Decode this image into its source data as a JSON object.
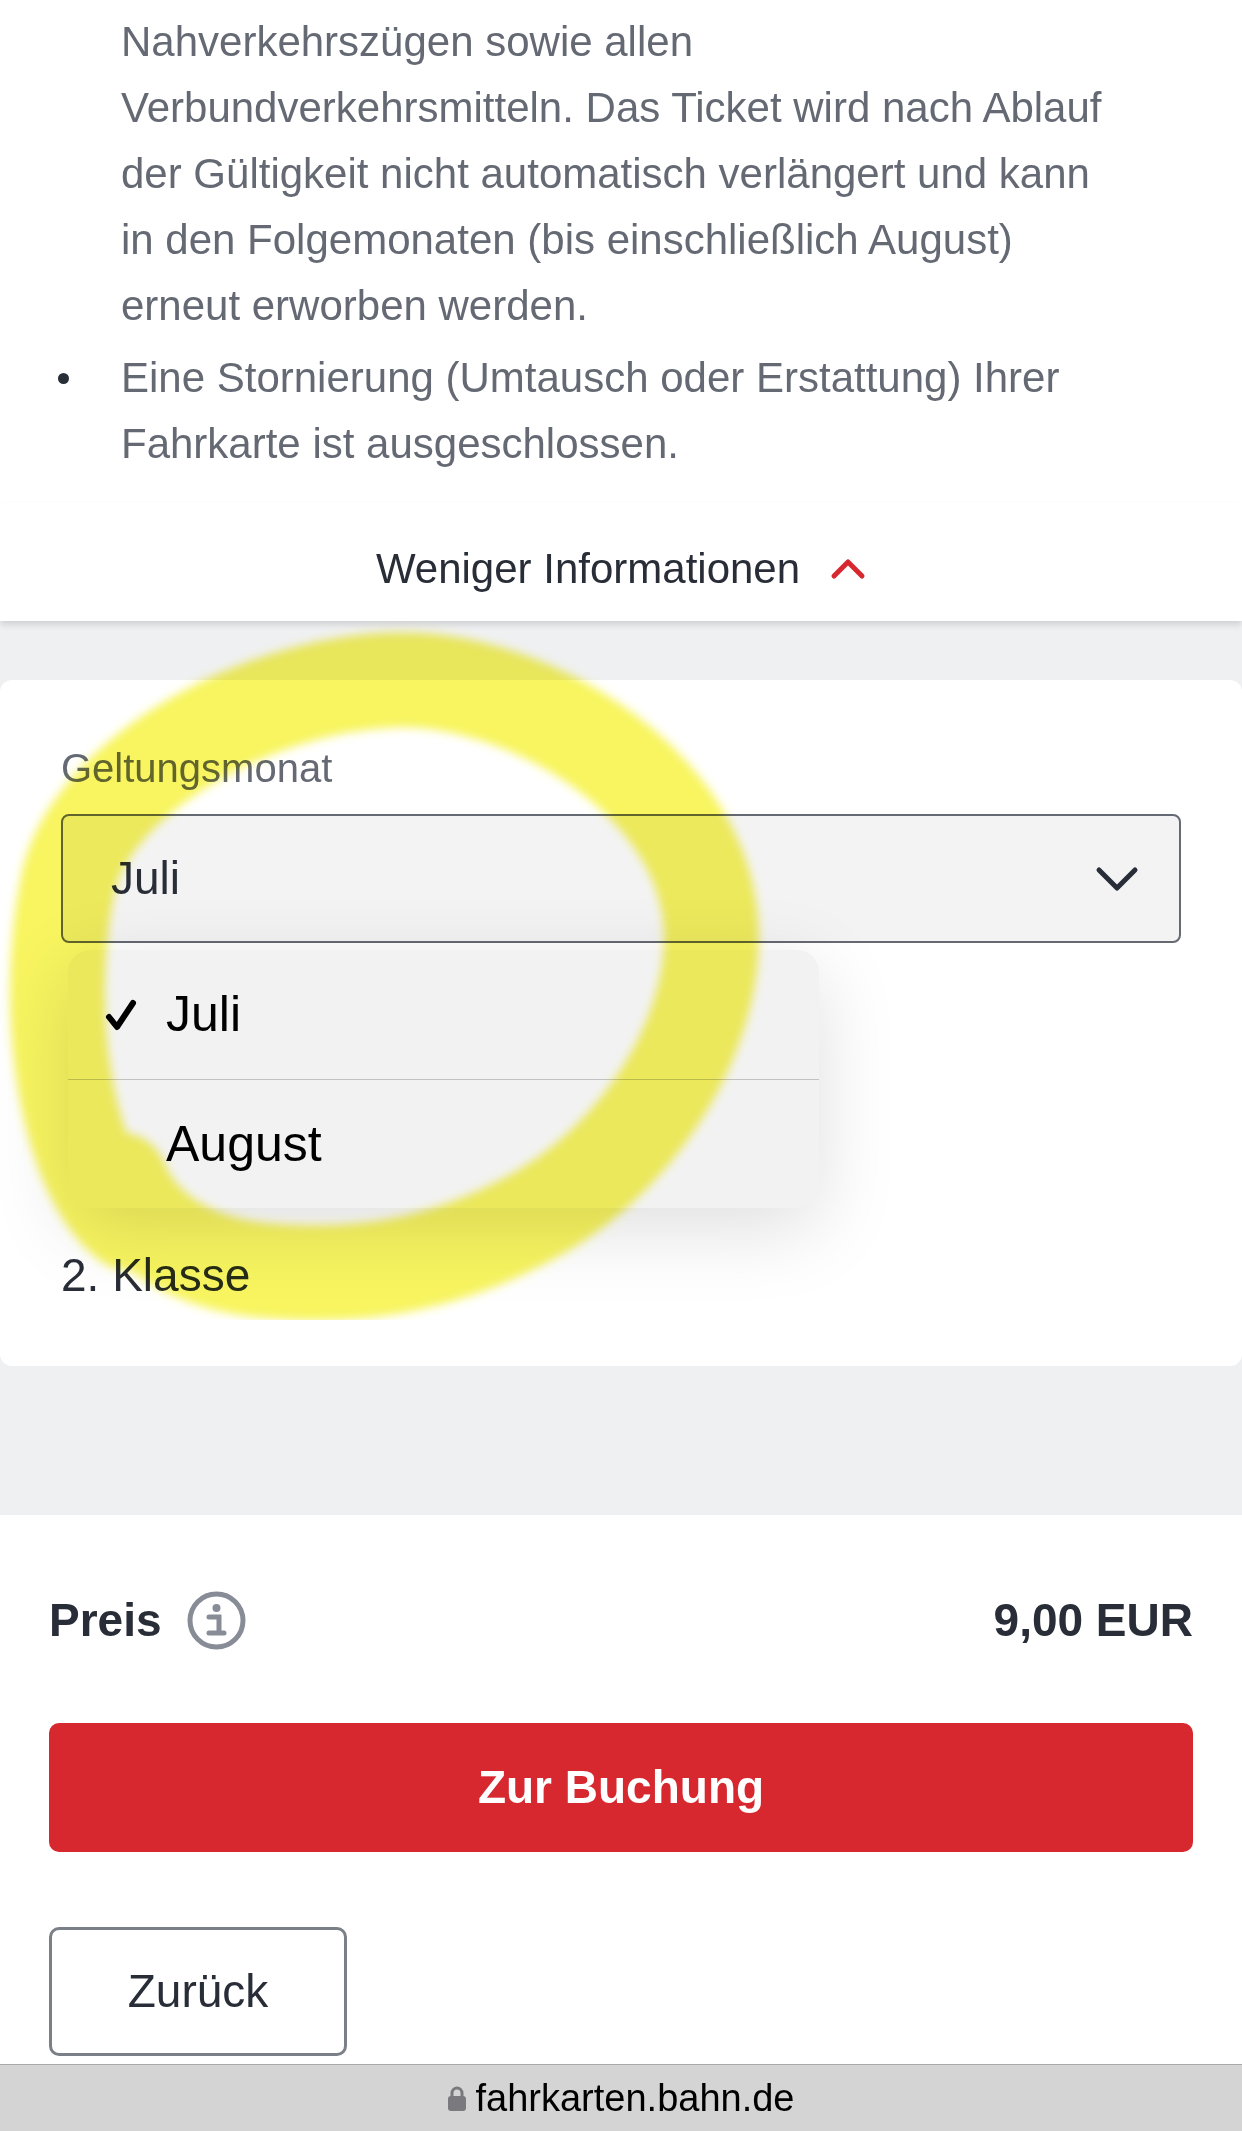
{
  "info_list": {
    "items": [
      {
        "kind": "continuation",
        "text": "Nahverkehrszügen sowie allen Verbundverkehrsmitteln. Das Ticket wird nach Ablauf der Gültigkeit nicht automatisch verlängert und kann in den Folgemonaten (bis einschließlich August) erneut erworben werden."
      },
      {
        "kind": "bullet",
        "text": "Eine Stornierung (Umtausch oder Erstattung) Ihrer Fahrkarte ist ausgeschlossen."
      }
    ],
    "toggle": {
      "label": "Weniger Informationen",
      "expanded": true
    }
  },
  "ticket_options": {
    "month_select": {
      "label": "Geltungsmonat",
      "value": "Juli",
      "expanded": true,
      "options": [
        {
          "label": "Juli",
          "selected": true
        },
        {
          "label": "August",
          "selected": false
        }
      ]
    },
    "travel_class": "2. Klasse"
  },
  "price": {
    "label": "Preis",
    "amount": "9,00 EUR"
  },
  "buttons": [
    {
      "kind": "primary",
      "label": "Zur Buchung"
    },
    {
      "kind": "secondary",
      "label": "Zurück"
    }
  ],
  "browser_bar": {
    "url": "fahrkarten.bahn.de",
    "secure": true
  },
  "overlay_marks": [
    {
      "kind": "highlighter_loop"
    }
  ]
}
